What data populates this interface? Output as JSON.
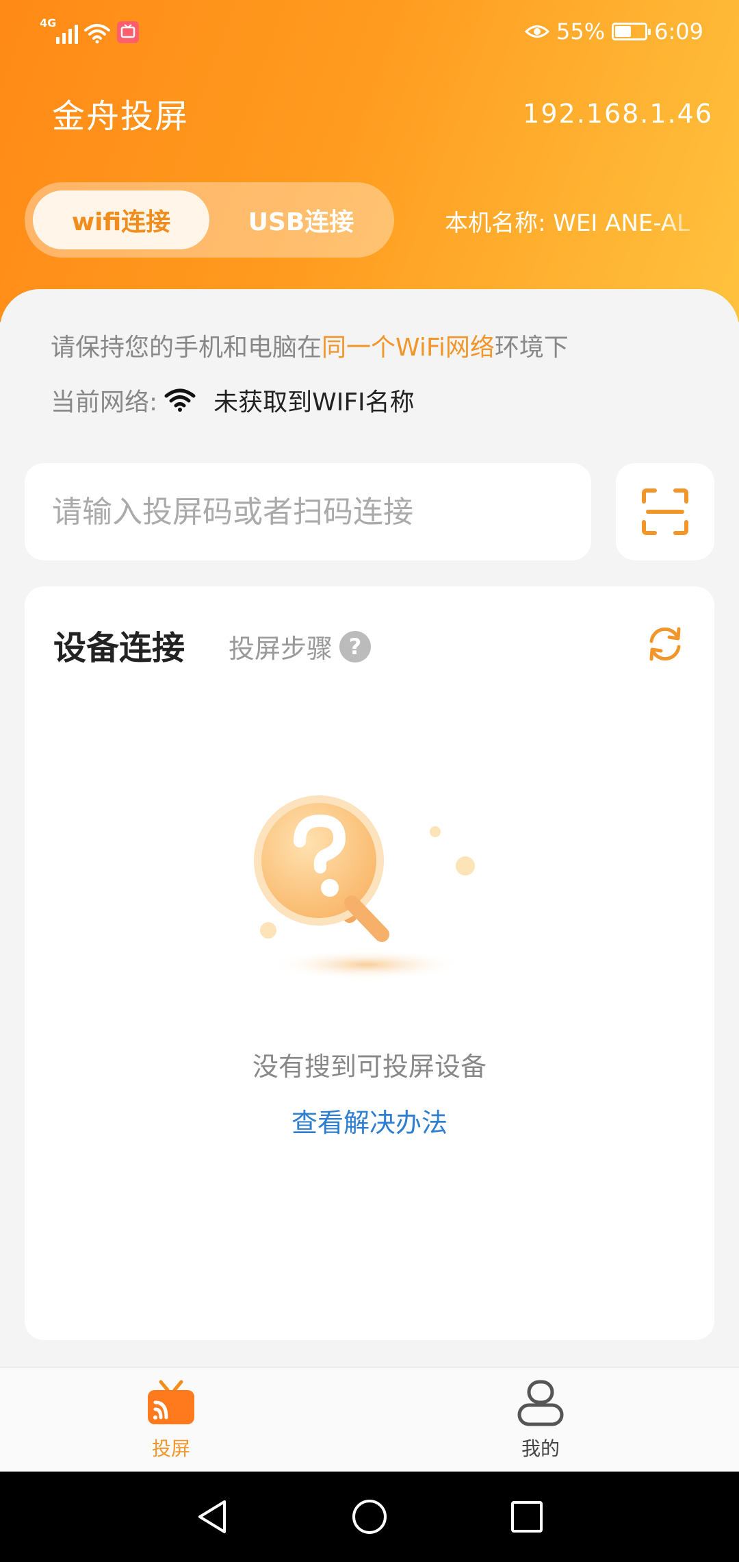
{
  "status_bar": {
    "network": "4G",
    "battery_percent": "55%",
    "battery_level": 0.55,
    "time": "6:09"
  },
  "header": {
    "app_title": "金舟投屏",
    "ip_address": "192.168.1.46",
    "tabs": {
      "wifi_label": "wifi连接",
      "usb_label": "USB连接",
      "active": "wifi"
    },
    "device_name": "本机名称: WEI ANE-AL"
  },
  "network_info": {
    "hint_prefix": "请保持您的手机和电脑在",
    "hint_highlight": "同一个WiFi网络",
    "hint_suffix": "环境下",
    "current_label": "当前网络:",
    "current_value": "未获取到WIFI名称"
  },
  "code_input": {
    "placeholder": "请输入投屏码或者扫码连接",
    "value": ""
  },
  "device_card": {
    "title": "设备连接",
    "steps_label": "投屏步骤",
    "help_glyph": "?",
    "empty_message": "没有搜到可投屏设备",
    "solution_link": "查看解决办法"
  },
  "bottom_nav": {
    "items": [
      {
        "label": "投屏",
        "active": true
      },
      {
        "label": "我的",
        "active": false
      }
    ]
  },
  "colors": {
    "accent": "#f0962a",
    "link": "#2f7fd1",
    "header_start": "#ff8a16",
    "header_end": "#ffc23e"
  }
}
